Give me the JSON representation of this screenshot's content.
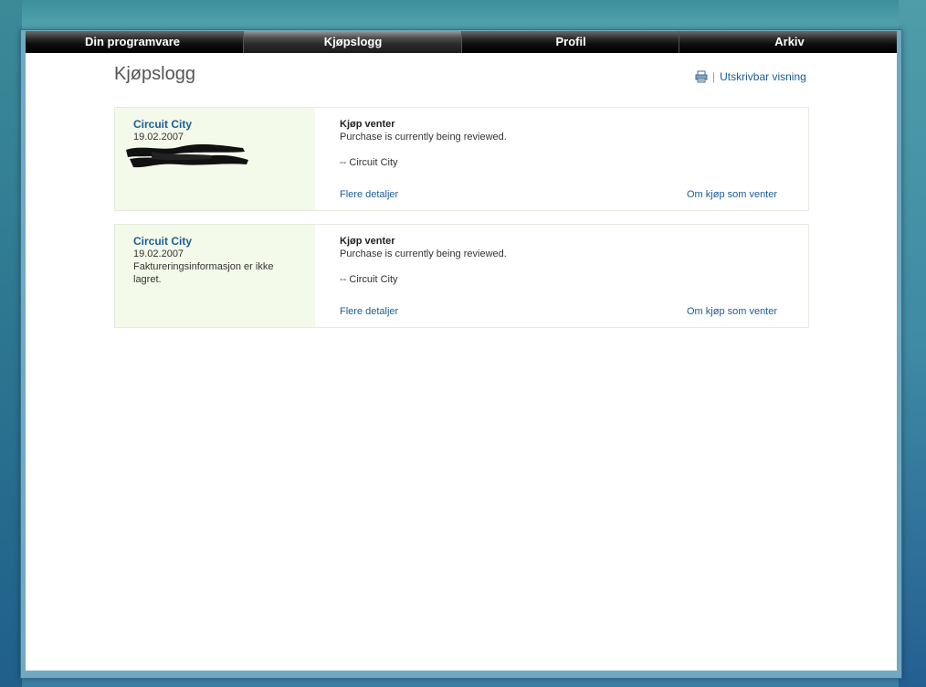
{
  "nav": {
    "tabs": [
      {
        "label": "Din programvare"
      },
      {
        "label": "Kjøpslogg"
      },
      {
        "label": "Profil"
      },
      {
        "label": "Arkiv"
      }
    ],
    "active_tab": "Kjøpslogg"
  },
  "page": {
    "title": "Kjøpslogg",
    "print_link": "Utskrivbar visning"
  },
  "orders": [
    {
      "merchant": "Circuit City",
      "date": "19.02.2007",
      "note": "",
      "status": "Kjøp venter",
      "message": "Purchase is currently being reviewed.",
      "signature": "-- Circuit City",
      "details_link": "Flere detaljer",
      "pending_link": "Om kjøp som venter"
    },
    {
      "merchant": "Circuit City",
      "date": "19.02.2007",
      "note": "Faktureringsinformasjon er ikke lagret.",
      "status": "Kjøp venter",
      "message": "Purchase is currently being reviewed.",
      "signature": "-- Circuit City",
      "details_link": "Flere detaljer",
      "pending_link": "Om kjøp som venter"
    }
  ],
  "colors": {
    "link": "#1a5c99",
    "card_left_bg": "#f4fae9",
    "navbar_bg": "#000000"
  }
}
